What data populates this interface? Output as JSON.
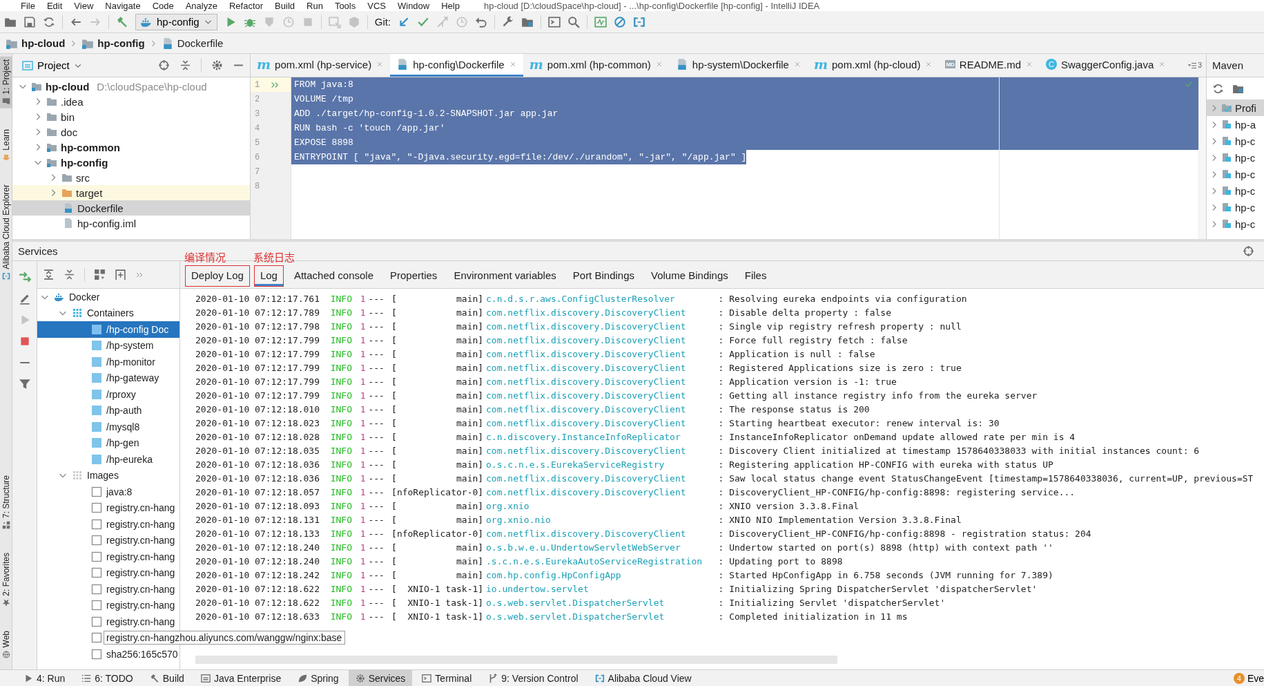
{
  "menu_bar": {
    "items": [
      "File",
      "Edit",
      "View",
      "Navigate",
      "Code",
      "Analyze",
      "Refactor",
      "Build",
      "Run",
      "Tools",
      "VCS",
      "Window",
      "Help"
    ],
    "title": "hp-cloud [D:\\cloudSpace\\hp-cloud] - ...\\hp-config\\Dockerfile [hp-config] - IntelliJ IDEA"
  },
  "toolbar": [
    {
      "kind": "open",
      "disabled": false
    },
    {
      "kind": "save",
      "disabled": false
    },
    {
      "kind": "sync",
      "disabled": false
    },
    {
      "kind": "separator"
    },
    {
      "kind": "back",
      "disabled": false
    },
    {
      "kind": "forward",
      "disabled": true
    },
    {
      "kind": "separator"
    },
    {
      "kind": "build",
      "disabled": false
    },
    {
      "kind": "config",
      "label": "hp-config"
    },
    {
      "kind": "run",
      "disabled": false
    },
    {
      "kind": "debug",
      "disabled": false
    },
    {
      "kind": "coverage",
      "disabled": true
    },
    {
      "kind": "profile",
      "disabled": true
    },
    {
      "kind": "stop",
      "disabled": true
    },
    {
      "kind": "separator"
    },
    {
      "kind": "attach",
      "disabled": true
    },
    {
      "kind": "cube",
      "disabled": true
    },
    {
      "kind": "separator"
    },
    {
      "kind": "label",
      "label": "Git:"
    },
    {
      "kind": "update",
      "disabled": false
    },
    {
      "kind": "commit",
      "disabled": false
    },
    {
      "kind": "merge",
      "disabled": true
    },
    {
      "kind": "history",
      "disabled": true
    },
    {
      "kind": "revert",
      "disabled": false
    },
    {
      "kind": "separator"
    },
    {
      "kind": "settings",
      "disabled": false
    },
    {
      "kind": "structure",
      "disabled": false
    },
    {
      "kind": "separator"
    },
    {
      "kind": "terminal",
      "disabled": false
    },
    {
      "kind": "search",
      "disabled": false
    },
    {
      "kind": "separator"
    },
    {
      "kind": "monitor",
      "disabled": false
    },
    {
      "kind": "block",
      "disabled": false
    },
    {
      "kind": "cloud",
      "disabled": false
    }
  ],
  "breadcrumb": [
    {
      "label": "hp-cloud",
      "kind": "module"
    },
    {
      "label": "hp-config",
      "kind": "module"
    },
    {
      "label": "Dockerfile",
      "kind": "docker-file"
    }
  ],
  "left_strip": {
    "top": [
      {
        "label": "1: Project",
        "kind": "project",
        "selected": true
      },
      {
        "label": "Learn",
        "kind": "learn",
        "selected": false
      },
      {
        "label": "Alibaba Cloud Explorer",
        "kind": "cloud",
        "selected": false
      }
    ],
    "bottom": [
      {
        "label": "7: Structure",
        "kind": "structure",
        "selected": false
      },
      {
        "label": "2: Favorites",
        "kind": "favorites",
        "selected": false
      },
      {
        "label": "Web",
        "kind": "web",
        "selected": false
      }
    ]
  },
  "project_panel": {
    "title": "Project",
    "tree": [
      {
        "label": "hp-cloud",
        "path": "D:\\cloudSpace\\hp-cloud",
        "kind": "module",
        "expanded": true,
        "selected": false,
        "ignored": false,
        "children": [
          {
            "label": ".idea",
            "kind": "folder",
            "expanded": false,
            "selected": false,
            "ignored": false
          },
          {
            "label": "bin",
            "kind": "folder",
            "expanded": false,
            "selected": false,
            "ignored": false
          },
          {
            "label": "doc",
            "kind": "folder",
            "expanded": false,
            "selected": false,
            "ignored": false
          },
          {
            "label": "hp-common",
            "kind": "module",
            "expanded": false,
            "selected": false,
            "ignored": false
          },
          {
            "label": "hp-config",
            "kind": "module",
            "expanded": true,
            "selected": false,
            "ignored": false,
            "children": [
              {
                "label": "src",
                "kind": "folder",
                "expanded": false,
                "selected": false,
                "ignored": false
              },
              {
                "label": "target",
                "kind": "output-folder",
                "expanded": false,
                "selected": false,
                "ignored": true
              },
              {
                "label": "Dockerfile",
                "kind": "docker-file",
                "selected": true,
                "ignored": false
              },
              {
                "label": "hp-config.iml",
                "kind": "module-file",
                "selected": false,
                "ignored": false
              }
            ]
          }
        ]
      }
    ]
  },
  "editor": {
    "tabs": [
      {
        "label": "pom.xml (hp-service)",
        "kind": "maven",
        "badge": "m",
        "selected": false
      },
      {
        "label": "hp-config\\Dockerfile",
        "kind": "docker-file",
        "selected": true
      },
      {
        "label": "pom.xml (hp-common)",
        "kind": "maven",
        "badge": "m",
        "selected": false
      },
      {
        "label": "hp-system\\Dockerfile",
        "kind": "docker-file",
        "selected": false
      },
      {
        "label": "pom.xml (hp-cloud)",
        "kind": "maven",
        "badge": "m",
        "selected": false
      },
      {
        "label": "README.md",
        "kind": "markdown",
        "badge": "MD",
        "selected": false
      },
      {
        "label": "SwaggerConfig.java",
        "kind": "class",
        "badge": "C",
        "selected": false
      }
    ],
    "hidden_tabs": "3",
    "lines": [
      {
        "number": "1",
        "text": "FROM java:8",
        "selected": true,
        "current": true,
        "run_marker": true
      },
      {
        "number": "2",
        "text": "VOLUME /tmp",
        "selected": true,
        "current": false,
        "run_marker": false
      },
      {
        "number": "3",
        "text": "ADD ./target/hp-config-1.0.2-SNAPSHOT.jar app.jar",
        "selected": true,
        "current": false,
        "run_marker": false
      },
      {
        "number": "4",
        "text": "RUN bash -c 'touch /app.jar'",
        "selected": true,
        "current": false,
        "run_marker": false
      },
      {
        "number": "5",
        "text": "EXPOSE 8898",
        "selected": true,
        "current": false,
        "run_marker": false
      },
      {
        "number": "6",
        "text": "ENTRYPOINT [ \"java\", \"-Djava.security.egd=file:/dev/./urandom\", \"-jar\", \"/app.jar\" ]",
        "selected": true,
        "current": false,
        "run_marker": false
      },
      {
        "number": "7",
        "selected": false,
        "current": false,
        "run_marker": false
      },
      {
        "number": "8",
        "selected": false,
        "current": false,
        "run_marker": false
      }
    ]
  },
  "maven_panel": {
    "title": "Maven",
    "items": [
      {
        "label": "Profi",
        "kind": "profiles",
        "selected": true
      },
      {
        "label": "hp-a",
        "kind": "module",
        "selected": false
      },
      {
        "label": "hp-c",
        "kind": "module",
        "selected": false
      },
      {
        "label": "hp-c",
        "kind": "module",
        "selected": false
      },
      {
        "label": "hp-c",
        "kind": "module",
        "selected": false
      },
      {
        "label": "hp-c",
        "kind": "module",
        "selected": false
      },
      {
        "label": "hp-c",
        "kind": "module",
        "selected": false
      },
      {
        "label": "hp-c",
        "kind": "module",
        "selected": false
      }
    ]
  },
  "services": {
    "title": "Services",
    "tree": [
      {
        "label": "Docker",
        "kind": "docker",
        "expanded": true,
        "selected": false,
        "hovered": false,
        "children": [
          {
            "label": "Containers",
            "kind": "containers",
            "expanded": true,
            "selected": false,
            "hovered": false,
            "children": [
              {
                "label": "/hp-config Doc",
                "kind": "container",
                "selected": true,
                "hovered": false
              },
              {
                "label": "/hp-system",
                "kind": "container",
                "selected": false,
                "hovered": false
              },
              {
                "label": "/hp-monitor",
                "kind": "container",
                "selected": false,
                "hovered": false
              },
              {
                "label": "/hp-gateway",
                "kind": "container",
                "selected": false,
                "hovered": false
              },
              {
                "label": "/rproxy",
                "kind": "container",
                "selected": false,
                "hovered": false
              },
              {
                "label": "/hp-auth",
                "kind": "container",
                "selected": false,
                "hovered": false
              },
              {
                "label": "/mysql8",
                "kind": "container",
                "selected": false,
                "hovered": false
              },
              {
                "label": "/hp-gen",
                "kind": "container",
                "selected": false,
                "hovered": false
              },
              {
                "label": "/hp-eureka",
                "kind": "container",
                "selected": false,
                "hovered": false
              }
            ]
          },
          {
            "label": "Images",
            "kind": "images",
            "expanded": true,
            "selected": false,
            "hovered": false,
            "children": [
              {
                "label": "java:8",
                "kind": "image",
                "selected": false,
                "hovered": false
              },
              {
                "label": "registry.cn-hang",
                "kind": "image",
                "selected": false,
                "hovered": false
              },
              {
                "label": "registry.cn-hang",
                "kind": "image",
                "selected": false,
                "hovered": false
              },
              {
                "label": "registry.cn-hang",
                "kind": "image",
                "selected": false,
                "hovered": false
              },
              {
                "label": "registry.cn-hang",
                "kind": "image",
                "selected": false,
                "hovered": false
              },
              {
                "label": "registry.cn-hang",
                "kind": "image",
                "selected": false,
                "hovered": false
              },
              {
                "label": "registry.cn-hang",
                "kind": "image",
                "selected": false,
                "hovered": false
              },
              {
                "label": "registry.cn-hang",
                "kind": "image",
                "selected": false,
                "hovered": false
              },
              {
                "label": "registry.cn-hang",
                "kind": "image",
                "selected": false,
                "hovered": false
              },
              {
                "label": "registry.cn-hangzhou.aliyuncs.com/wanggw/nginx:base",
                "kind": "image",
                "selected": false,
                "hovered": true
              },
              {
                "label": "sha256:165c570",
                "kind": "image",
                "selected": false,
                "hovered": false
              }
            ]
          }
        ]
      }
    ],
    "tabs": [
      {
        "label": "Deploy Log",
        "selected": false,
        "annotation": "编译情况"
      },
      {
        "label": "Log",
        "selected": true,
        "annotation": "系统日志"
      },
      {
        "label": "Attached console",
        "selected": false
      },
      {
        "label": "Properties",
        "selected": false
      },
      {
        "label": "Environment variables",
        "selected": false
      },
      {
        "label": "Port Bindings",
        "selected": false
      },
      {
        "label": "Volume Bindings",
        "selected": false
      },
      {
        "label": "Files",
        "selected": false
      }
    ],
    "log": [
      {
        "time": "2020-01-10 07:12:17.761",
        "level": "INFO",
        "pid": "1",
        "sep": "---",
        "thread": "[           main]",
        "logger": "c.n.d.s.r.aws.ConfigClusterResolver",
        "message": ": Resolving eureka endpoints via configuration"
      },
      {
        "time": "2020-01-10 07:12:17.789",
        "level": "INFO",
        "pid": "1",
        "sep": "---",
        "thread": "[           main]",
        "logger": "com.netflix.discovery.DiscoveryClient",
        "message": ": Disable delta property : false"
      },
      {
        "time": "2020-01-10 07:12:17.798",
        "level": "INFO",
        "pid": "1",
        "sep": "---",
        "thread": "[           main]",
        "logger": "com.netflix.discovery.DiscoveryClient",
        "message": ": Single vip registry refresh property : null"
      },
      {
        "time": "2020-01-10 07:12:17.799",
        "level": "INFO",
        "pid": "1",
        "sep": "---",
        "thread": "[           main]",
        "logger": "com.netflix.discovery.DiscoveryClient",
        "message": ": Force full registry fetch : false"
      },
      {
        "time": "2020-01-10 07:12:17.799",
        "level": "INFO",
        "pid": "1",
        "sep": "---",
        "thread": "[           main]",
        "logger": "com.netflix.discovery.DiscoveryClient",
        "message": ": Application is null : false"
      },
      {
        "time": "2020-01-10 07:12:17.799",
        "level": "INFO",
        "pid": "1",
        "sep": "---",
        "thread": "[           main]",
        "logger": "com.netflix.discovery.DiscoveryClient",
        "message": ": Registered Applications size is zero : true"
      },
      {
        "time": "2020-01-10 07:12:17.799",
        "level": "INFO",
        "pid": "1",
        "sep": "---",
        "thread": "[           main]",
        "logger": "com.netflix.discovery.DiscoveryClient",
        "message": ": Application version is -1: true"
      },
      {
        "time": "2020-01-10 07:12:17.799",
        "level": "INFO",
        "pid": "1",
        "sep": "---",
        "thread": "[           main]",
        "logger": "com.netflix.discovery.DiscoveryClient",
        "message": ": Getting all instance registry info from the eureka server"
      },
      {
        "time": "2020-01-10 07:12:18.010",
        "level": "INFO",
        "pid": "1",
        "sep": "---",
        "thread": "[           main]",
        "logger": "com.netflix.discovery.DiscoveryClient",
        "message": ": The response status is 200"
      },
      {
        "time": "2020-01-10 07:12:18.023",
        "level": "INFO",
        "pid": "1",
        "sep": "---",
        "thread": "[           main]",
        "logger": "com.netflix.discovery.DiscoveryClient",
        "message": ": Starting heartbeat executor: renew interval is: 30"
      },
      {
        "time": "2020-01-10 07:12:18.028",
        "level": "INFO",
        "pid": "1",
        "sep": "---",
        "thread": "[           main]",
        "logger": "c.n.discovery.InstanceInfoReplicator",
        "message": ": InstanceInfoReplicator onDemand update allowed rate per min is 4"
      },
      {
        "time": "2020-01-10 07:12:18.035",
        "level": "INFO",
        "pid": "1",
        "sep": "---",
        "thread": "[           main]",
        "logger": "com.netflix.discovery.DiscoveryClient",
        "message": ": Discovery Client initialized at timestamp 1578640338033 with initial instances count: 6"
      },
      {
        "time": "2020-01-10 07:12:18.036",
        "level": "INFO",
        "pid": "1",
        "sep": "---",
        "thread": "[           main]",
        "logger": "o.s.c.n.e.s.EurekaServiceRegistry",
        "message": ": Registering application HP-CONFIG with eureka with status UP"
      },
      {
        "time": "2020-01-10 07:12:18.036",
        "level": "INFO",
        "pid": "1",
        "sep": "---",
        "thread": "[           main]",
        "logger": "com.netflix.discovery.DiscoveryClient",
        "message": ": Saw local status change event StatusChangeEvent [timestamp=1578640338036, current=UP, previous=ST"
      },
      {
        "time": "2020-01-10 07:12:18.057",
        "level": "INFO",
        "pid": "1",
        "sep": "---",
        "thread": "[nfoReplicator-0]",
        "logger": "com.netflix.discovery.DiscoveryClient",
        "message": ": DiscoveryClient_HP-CONFIG/hp-config:8898: registering service..."
      },
      {
        "time": "2020-01-10 07:12:18.093",
        "level": "INFO",
        "pid": "1",
        "sep": "---",
        "thread": "[           main]",
        "logger": "org.xnio",
        "message": ": XNIO version 3.3.8.Final"
      },
      {
        "time": "2020-01-10 07:12:18.131",
        "level": "INFO",
        "pid": "1",
        "sep": "---",
        "thread": "[           main]",
        "logger": "org.xnio.nio",
        "message": ": XNIO NIO Implementation Version 3.3.8.Final"
      },
      {
        "time": "2020-01-10 07:12:18.133",
        "level": "INFO",
        "pid": "1",
        "sep": "---",
        "thread": "[nfoReplicator-0]",
        "logger": "com.netflix.discovery.DiscoveryClient",
        "message": ": DiscoveryClient_HP-CONFIG/hp-config:8898 - registration status: 204"
      },
      {
        "time": "2020-01-10 07:12:18.240",
        "level": "INFO",
        "pid": "1",
        "sep": "---",
        "thread": "[           main]",
        "logger": "o.s.b.w.e.u.UndertowServletWebServer",
        "message": ": Undertow started on port(s) 8898 (http) with context path ''"
      },
      {
        "time": "2020-01-10 07:12:18.240",
        "level": "INFO",
        "pid": "1",
        "sep": "---",
        "thread": "[           main]",
        "logger": ".s.c.n.e.s.EurekaAutoServiceRegistration",
        "message": ": Updating port to 8898"
      },
      {
        "time": "2020-01-10 07:12:18.242",
        "level": "INFO",
        "pid": "1",
        "sep": "---",
        "thread": "[           main]",
        "logger": "com.hp.config.HpConfigApp",
        "message": ": Started HpConfigApp in 6.758 seconds (JVM running for 7.389)"
      },
      {
        "time": "2020-01-10 07:12:18.622",
        "level": "INFO",
        "pid": "1",
        "sep": "---",
        "thread": "[  XNIO-1 task-1]",
        "logger": "io.undertow.servlet",
        "message": ": Initializing Spring DispatcherServlet 'dispatcherServlet'"
      },
      {
        "time": "2020-01-10 07:12:18.622",
        "level": "INFO",
        "pid": "1",
        "sep": "---",
        "thread": "[  XNIO-1 task-1]",
        "logger": "o.s.web.servlet.DispatcherServlet",
        "message": ": Initializing Servlet 'dispatcherServlet'"
      },
      {
        "time": "2020-01-10 07:12:18.633",
        "level": "INFO",
        "pid": "1",
        "sep": "---",
        "thread": "[  XNIO-1 task-1]",
        "logger": "o.s.web.servlet.DispatcherServlet",
        "message": ": Completed initialization in 11 ms"
      }
    ]
  },
  "bottom_bar": {
    "items": [
      {
        "label": "4: Run",
        "kind": "run",
        "selected": false
      },
      {
        "label": "6: TODO",
        "kind": "todo",
        "selected": false
      },
      {
        "label": "Build",
        "kind": "build",
        "selected": false
      },
      {
        "label": "Java Enterprise",
        "kind": "enterprise",
        "selected": false
      },
      {
        "label": "Spring",
        "kind": "spring",
        "selected": false
      },
      {
        "label": "Services",
        "kind": "services",
        "selected": true
      },
      {
        "label": "Terminal",
        "kind": "terminal",
        "selected": false
      },
      {
        "label": "9: Version Control",
        "kind": "vcs",
        "selected": false
      },
      {
        "label": "Alibaba Cloud View",
        "kind": "cloud",
        "selected": false
      }
    ],
    "event_log": {
      "count": "4",
      "label": "Eve"
    }
  }
}
